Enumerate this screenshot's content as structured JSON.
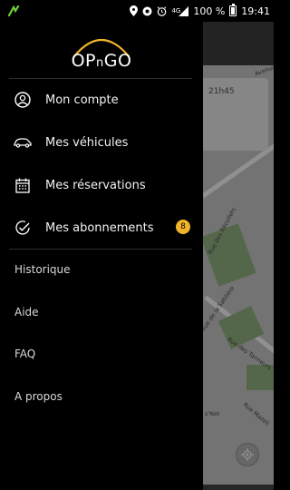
{
  "status_bar": {
    "network_tag": "4G",
    "battery_text": "100 %",
    "time": "19:41"
  },
  "brand": {
    "logo_text_a": "OP",
    "logo_text_n": "n",
    "logo_text_b": "GO",
    "accent_color": "#f0b429"
  },
  "drawer": {
    "primary_items": [
      {
        "label": "Mon compte",
        "icon": "user-circle-icon"
      },
      {
        "label": "Mes véhicules",
        "icon": "car-icon"
      },
      {
        "label": "Mes réservations",
        "icon": "calendar-icon"
      },
      {
        "label": "Mes abonnements",
        "icon": "check-circle-icon",
        "badge": "8"
      }
    ],
    "secondary_items": [
      {
        "label": "Historique"
      },
      {
        "label": "Aide"
      },
      {
        "label": "FAQ"
      },
      {
        "label": "A propos"
      }
    ]
  },
  "map": {
    "card_time": "21h45",
    "street_labels": [
      "Rue des Récollets",
      "Rue de la Sablière",
      "Rue des Tanneurs",
      "Rue Mazeli",
      "s'Net",
      "Avenue"
    ]
  }
}
